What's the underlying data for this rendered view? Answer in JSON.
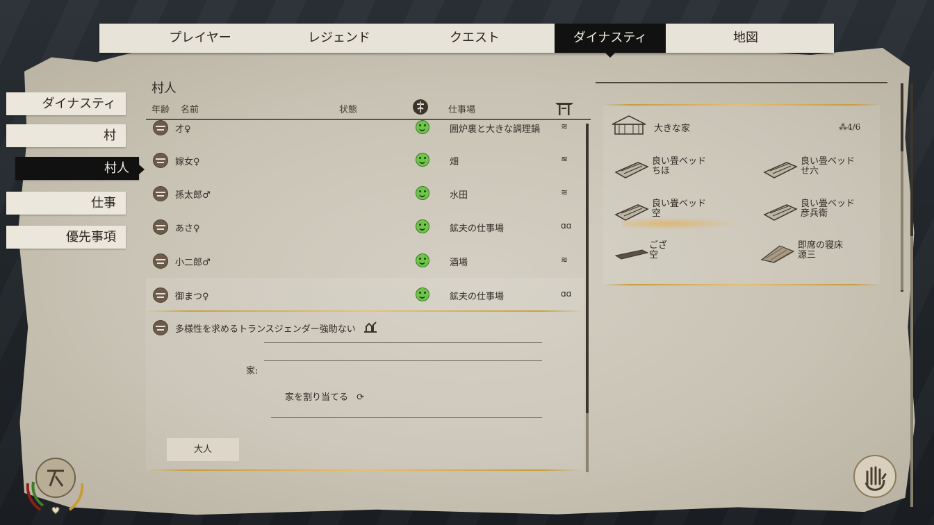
{
  "top_tabs": [
    "プレイヤー",
    "レジェンド",
    "クエスト",
    "ダイナスティ",
    "地図"
  ],
  "active_top_tab": "ダイナスティ",
  "side_nav": [
    "ダイナスティ",
    "村",
    "村人",
    "仕事",
    "優先事項"
  ],
  "active_side_nav": "村人",
  "villagers": {
    "title": "村人",
    "col_age": "年齢",
    "col_name": "名前",
    "col_status": "状態",
    "col_workplace": "仕事場",
    "rows": [
      {
        "name": "才♀",
        "workplace": "囲炉裏と大きな調理鍋",
        "work_icon": "≋"
      },
      {
        "name": "嫁女♀",
        "workplace": "畑",
        "work_icon": "≋"
      },
      {
        "name": "孫太郎♂",
        "workplace": "水田",
        "work_icon": "≋"
      },
      {
        "name": "あさ♀",
        "workplace": "鉱夫の仕事場",
        "work_icon": "ɑɑ"
      },
      {
        "name": "小二郎♂",
        "workplace": "酒場",
        "work_icon": "≋"
      },
      {
        "name": "御まつ♀",
        "workplace": "鉱夫の仕事場",
        "work_icon": "ɑɑ"
      }
    ]
  },
  "detail": {
    "trait": "多様性を求めるトランスジェンダー強助ない",
    "house_label": "家:",
    "assign_label": "家を割り当てる",
    "age_badge": "大人"
  },
  "house": {
    "name": "大きな家",
    "capacity": "4/6",
    "beds": [
      {
        "type": "良い畳ベッド",
        "owner": "ちほ"
      },
      {
        "type": "良い畳ベッド",
        "owner": "せ六"
      },
      {
        "type": "良い畳ベッド",
        "owner": "空"
      },
      {
        "type": "良い畳ベッド",
        "owner": "彦兵衛"
      },
      {
        "type": "ござ",
        "owner": "空"
      },
      {
        "type": "即席の寝床",
        "owner": "源三"
      }
    ]
  },
  "colors": {
    "parchment": "#c9c3b5",
    "active_tab": "#111111",
    "happy_green": "#6fc44a",
    "gold_accent": "#c89c3a"
  }
}
